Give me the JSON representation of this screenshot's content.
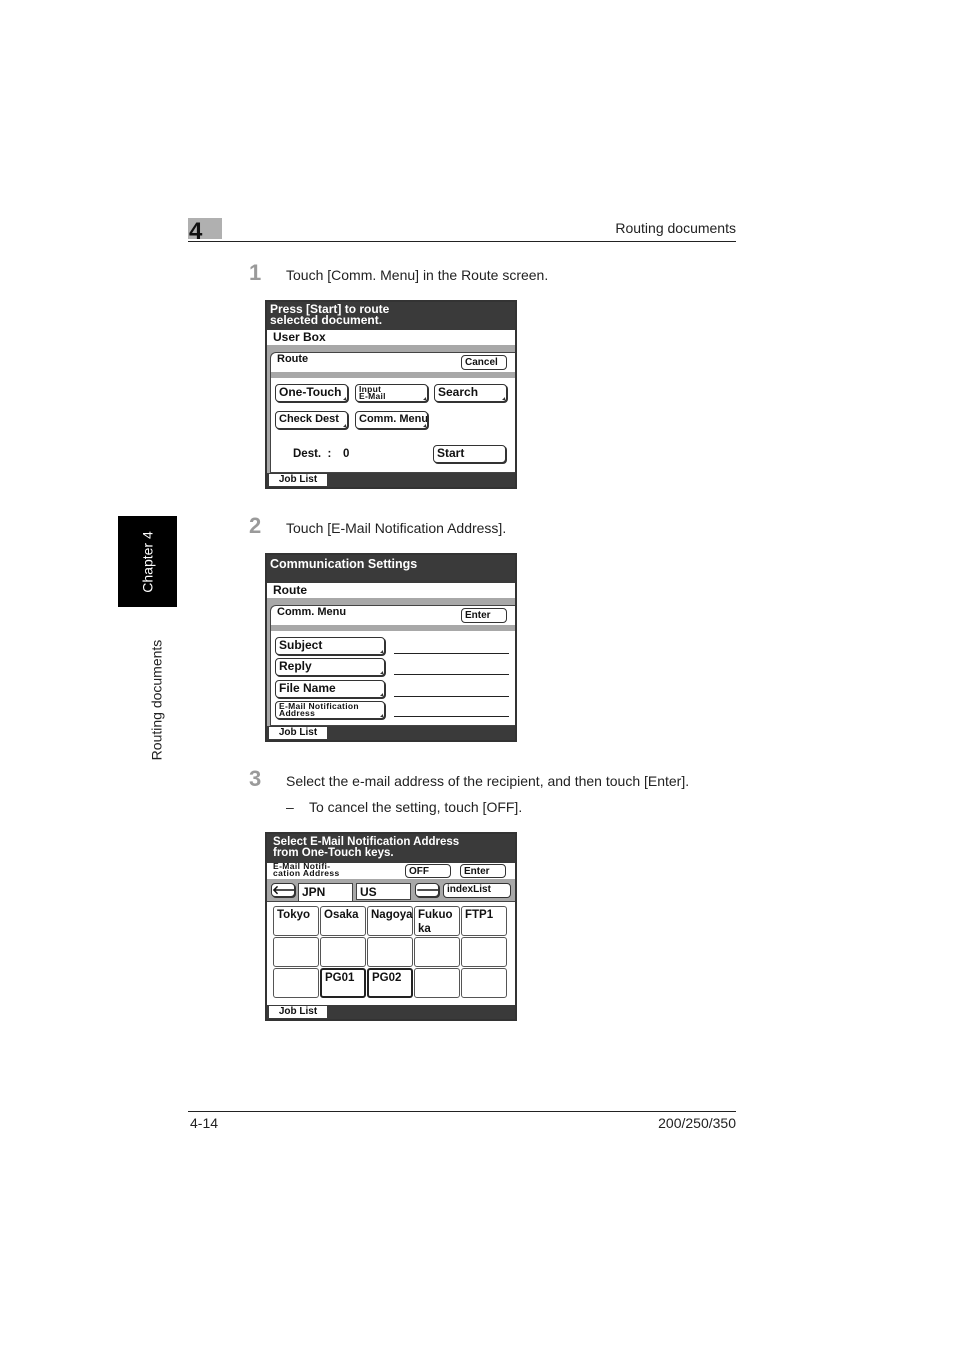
{
  "header": {
    "chapter_number": "4",
    "section_title": "Routing documents"
  },
  "side_tab": {
    "chapter_label": "Chapter 4",
    "section_label": "Routing documents"
  },
  "steps": [
    {
      "number": "1",
      "text": "Touch [Comm. Menu] in the Route screen."
    },
    {
      "number": "2",
      "text": "Touch [E-Mail Notification Address]."
    },
    {
      "number": "3",
      "text": "Select the e-mail address of the recipient, and then touch [Enter].",
      "substep": {
        "bullet": "–",
        "text": "To cancel the setting, touch [OFF]."
      }
    }
  ],
  "screen1": {
    "message_line1": "Press [Start] to route",
    "message_line2": "selected document.",
    "breadcrumb": "User Box",
    "panel_title": "Route",
    "cancel_label": "Cancel",
    "buttons": {
      "one_touch": "One-Touch",
      "input_email_line1": "Input",
      "input_email_line2": "E-Mail",
      "search": "Search",
      "check_dest": "Check Dest",
      "comm_menu": "Comm. Menu"
    },
    "dest_label": "Dest.  :",
    "dest_count": "0",
    "start_label": "Start",
    "job_list_label": "Job List"
  },
  "screen2": {
    "message": "Communication Settings",
    "breadcrumb": "Route",
    "panel_title": "Comm. Menu",
    "enter_label": "Enter",
    "buttons": {
      "subject": "Subject",
      "reply": "Reply",
      "file_name": "File Name",
      "email_notification_line1": "E-Mail Notification",
      "email_notification_line2": "Address"
    },
    "job_list_label": "Job List"
  },
  "screen3": {
    "message_line1": "Select E-Mail Notification Address",
    "message_line2": "from One-Touch keys.",
    "field_label_line1": "E-Mail Notifi-",
    "field_label_line2": "cation Address",
    "off_label": "OFF",
    "enter_label": "Enter",
    "prev_icon": "left-arrow-icon",
    "next_icon": "right-arrow-icon",
    "tabs": [
      "JPN",
      "US"
    ],
    "index_list_label": "indexList",
    "grid": [
      [
        "Tokyo",
        "Osaka",
        "Nagoya",
        "Fukuo\nka",
        "FTP1"
      ],
      [
        "",
        "",
        "",
        "",
        ""
      ],
      [
        "",
        "PG01",
        "PG02",
        "",
        ""
      ]
    ],
    "job_list_label": "Job List"
  },
  "footer": {
    "page_number": "4-14",
    "model": "200/250/350"
  }
}
